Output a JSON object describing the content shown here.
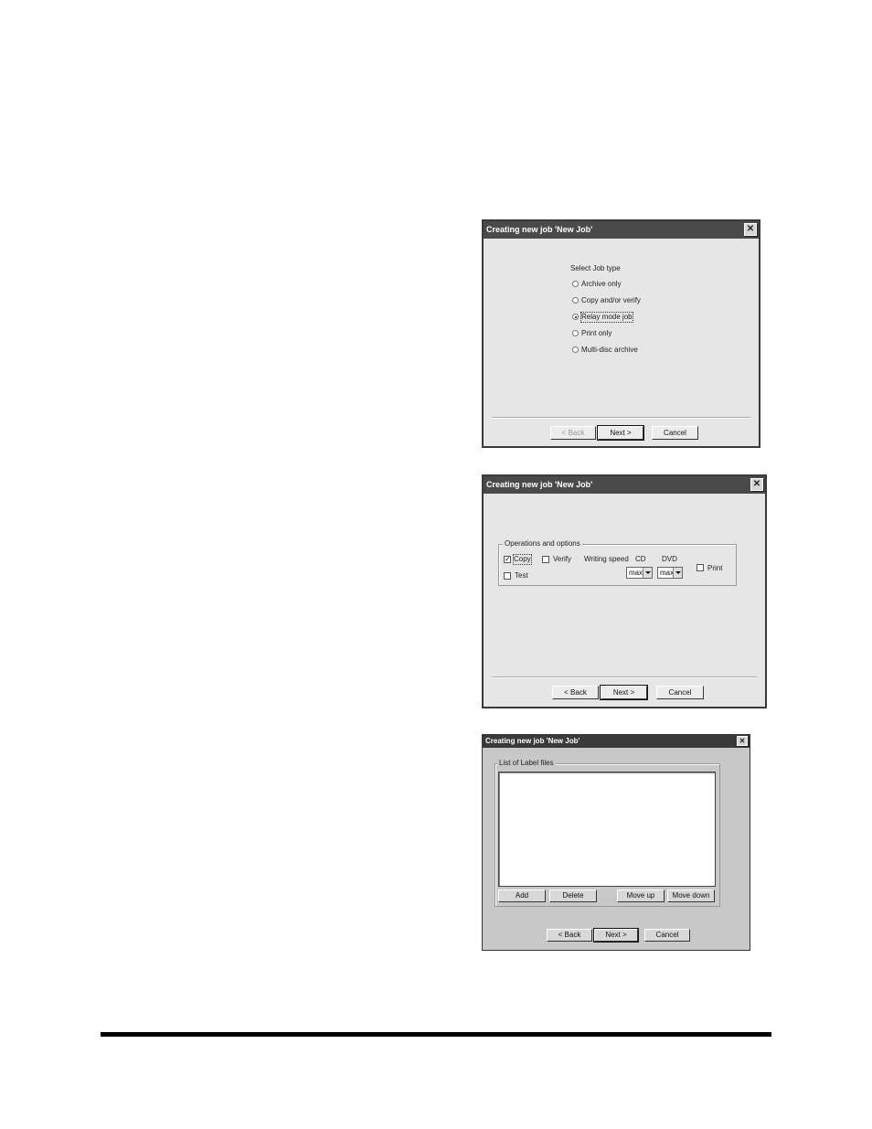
{
  "dialog1": {
    "title": "Creating new job 'New Job'",
    "close": "✕",
    "heading": "Select Job type",
    "options": [
      {
        "label": "Archive only",
        "selected": false
      },
      {
        "label": "Copy and/or verify",
        "selected": false
      },
      {
        "label": "Relay mode job",
        "selected": true
      },
      {
        "label": "Print only",
        "selected": false
      },
      {
        "label": "Multi-disc archive",
        "selected": false
      }
    ],
    "back_label": "< Back",
    "next_label": "Next >",
    "cancel_label": "Cancel"
  },
  "dialog2": {
    "title": "Creating new job 'New Job'",
    "close": "✕",
    "group_label": "Operations and options",
    "copy_label": "Copy",
    "copy_checked": true,
    "check_mark": "✓",
    "verify_label": "Verify",
    "writing_speed_label": "Writing speed",
    "cd_label": "CD",
    "dvd_label": "DVD",
    "cd_value": "max",
    "dvd_value": "max",
    "test_label": "Test",
    "print_label": "Print",
    "back_label": "< Back",
    "next_label": "Next >",
    "cancel_label": "Cancel"
  },
  "dialog3": {
    "title": "Creating new job 'New Job'",
    "close": "✕",
    "group_label": "List of Label files",
    "add_label": "Add",
    "delete_label": "Delete",
    "move_up_label": "Move up",
    "move_down_label": "Move down",
    "back_label": "< Back",
    "next_label": "Next >",
    "cancel_label": "Cancel"
  },
  "colors": {
    "titlebar": "#4a4a4a",
    "dialog_bg": "#e6e6e6",
    "rule": "#000000"
  }
}
